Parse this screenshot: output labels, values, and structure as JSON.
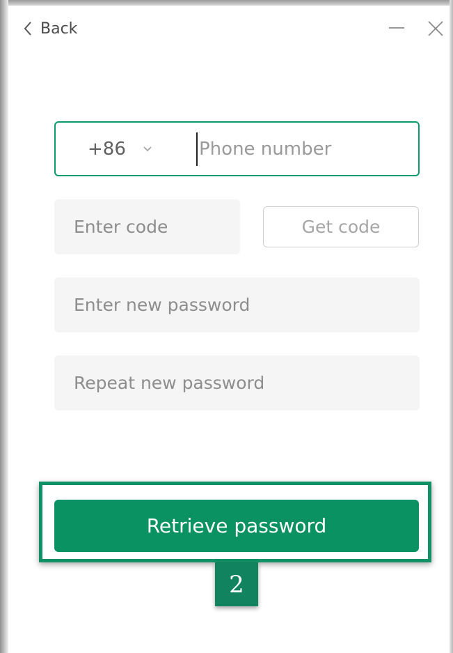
{
  "titlebar": {
    "back_label": "Back",
    "icons": {
      "back": "chevron-left-icon",
      "minimize": "minimize-icon",
      "close": "close-icon"
    }
  },
  "phone": {
    "country_code": "+86",
    "placeholder": "Phone number",
    "value": "",
    "dropdown_icon": "chevron-down-icon"
  },
  "code": {
    "placeholder": "Enter code",
    "get_code_label": "Get code"
  },
  "new_password": {
    "placeholder": "Enter new password"
  },
  "repeat_password": {
    "placeholder": "Repeat new password"
  },
  "submit": {
    "label": "Retrieve password"
  },
  "annotation": {
    "step": "2"
  },
  "colors": {
    "accent": "#0b9263",
    "field_bg": "#f5f5f5",
    "annotation": "#11845f"
  }
}
